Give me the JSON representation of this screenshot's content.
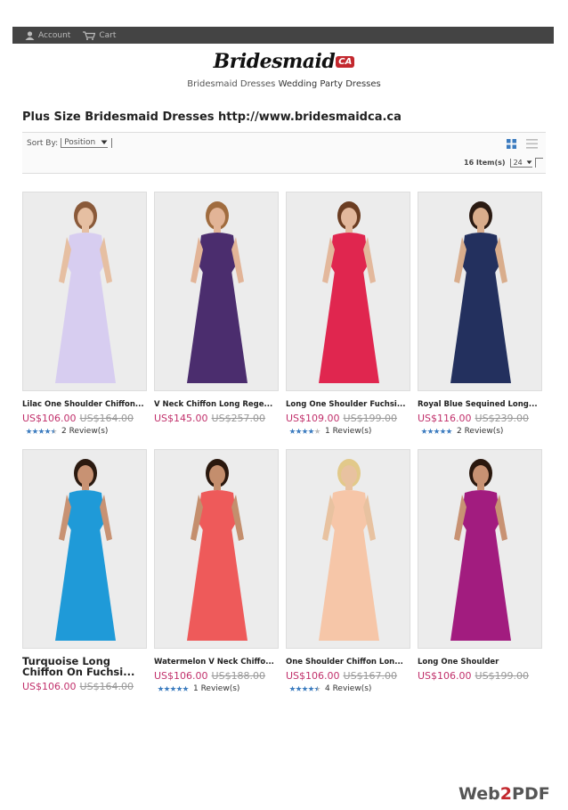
{
  "topbar": {
    "account": "Account",
    "cart": "Cart"
  },
  "logo": {
    "main": "Bridesmaid",
    "suffix": "CA"
  },
  "tagline": {
    "part1": "Bridesmaid Dresses",
    "part2": "Wedding Party Dresses"
  },
  "page_title": "Plus Size Bridesmaid Dresses http://www.bridesmaidca.ca",
  "toolbar": {
    "sort_label": "Sort By:",
    "sort_value": "Position",
    "items_label": "16 Item(s)",
    "per_page": "24"
  },
  "colors": {
    "price": "#c1306b",
    "topbar": "#444444",
    "star": "#3b7bbf"
  },
  "products": [
    {
      "name": "Lilac One Shoulder Chiffon...",
      "price": "US$106.00",
      "old": "US$164.00",
      "rating": 4.5,
      "reviews": "2 Review(s)",
      "dress": "#d7cdf0",
      "skin": "#e6bfa2",
      "hair": "#8a5a3a"
    },
    {
      "name": "V Neck Chiffon Long Rege...",
      "price": "US$145.00",
      "old": "US$257.00",
      "rating": 0,
      "reviews": "",
      "dress": "#4b2d6e",
      "skin": "#e2b497",
      "hair": "#a06c3f"
    },
    {
      "name": "Long One Shoulder Fuchsi...",
      "price": "US$109.00",
      "old": "US$199.00",
      "rating": 4,
      "reviews": "1 Review(s)",
      "dress": "#e0264f",
      "skin": "#e3b89c",
      "hair": "#6b3d22"
    },
    {
      "name": "Royal Blue Sequined Long...",
      "price": "US$116.00",
      "old": "US$239.00",
      "rating": 5,
      "reviews": "2 Review(s)",
      "dress": "#23305e",
      "skin": "#d9ad8c",
      "hair": "#2a1a12"
    },
    {
      "name": "Turquoise Long Chiffon On Fuchsi...",
      "price": "US$106.00",
      "old": "US$164.00",
      "rating": 0,
      "reviews": "",
      "dress": "#1f9ad8",
      "skin": "#c89273",
      "hair": "#2b1a10"
    },
    {
      "name": "Watermelon V Neck Chiffo...",
      "price": "US$106.00",
      "old": "US$188.00",
      "rating": 5,
      "reviews": "1 Review(s)",
      "dress": "#ee5a5a",
      "skin": "#c48e6d",
      "hair": "#2a180e"
    },
    {
      "name": "One Shoulder Chiffon Lon...",
      "price": "US$106.00",
      "old": "US$167.00",
      "rating": 4.5,
      "reviews": "4 Review(s)",
      "dress": "#f6c6a8",
      "skin": "#e8c2a0",
      "hair": "#e2c98a"
    },
    {
      "name": "Long One Shoulder",
      "price": "US$106.00",
      "old": "US$199.00",
      "rating": 0,
      "reviews": "",
      "dress": "#a21c7f",
      "skin": "#c89273",
      "hair": "#2a180e"
    }
  ],
  "footer": {
    "brand_a": "Web",
    "brand_b": "2",
    "brand_c": "PDF"
  }
}
